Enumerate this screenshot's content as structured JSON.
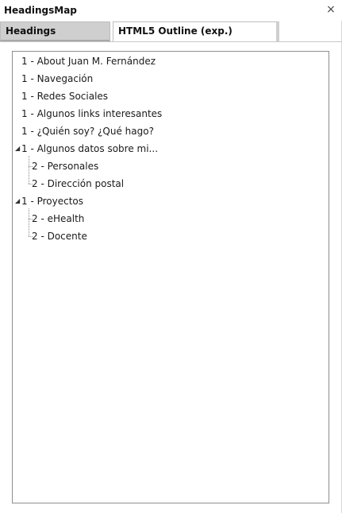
{
  "panel": {
    "title": "HeadingsMap",
    "close_symbol": "×"
  },
  "tabs": [
    {
      "label": "Headings",
      "selected": true
    },
    {
      "label": "HTML5 Outline (exp.)",
      "selected": false
    }
  ],
  "tree": {
    "items": [
      {
        "label": "1 - About Juan M. Fernández",
        "level": 1,
        "expandable": false
      },
      {
        "label": "1 - Navegación",
        "level": 1,
        "expandable": false
      },
      {
        "label": "1 - Redes Sociales",
        "level": 1,
        "expandable": false
      },
      {
        "label": "1 - Algunos links interesantes",
        "level": 1,
        "expandable": false
      },
      {
        "label": "1 - ¿Quién soy? ¿Qué hago?",
        "level": 1,
        "expandable": false
      },
      {
        "label": "1 - Algunos datos sobre mi...",
        "level": 1,
        "expandable": true,
        "expanded": true
      },
      {
        "label": "2 - Personales",
        "level": 2,
        "expandable": false
      },
      {
        "label": "2 - Dirección postal",
        "level": 2,
        "expandable": false
      },
      {
        "label": "1 - Proyectos",
        "level": 1,
        "expandable": true,
        "expanded": true
      },
      {
        "label": "2 - eHealth",
        "level": 2,
        "expandable": false
      },
      {
        "label": "2 - Docente",
        "level": 2,
        "expandable": false
      }
    ],
    "expanded_icon": "◢"
  }
}
